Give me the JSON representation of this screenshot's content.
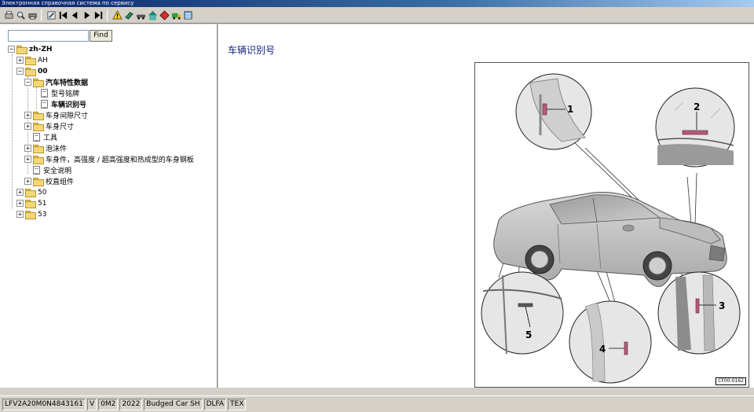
{
  "window": {
    "title": "Электронная справочная система по сервису"
  },
  "toolbar": {
    "icons": [
      "print-icon",
      "find-icon",
      "printer-icon",
      "settings-icon",
      "first-icon",
      "previous-icon",
      "next-icon",
      "last-icon",
      "warning-icon",
      "green-arrow-icon",
      "car-link-icon",
      "house-icon",
      "red-diamond-icon",
      "truck-icon",
      "list-icon"
    ]
  },
  "search": {
    "value": "",
    "button": "Find"
  },
  "tree": {
    "root": "zh-ZH",
    "items": [
      {
        "label": "AH"
      },
      {
        "label": "00"
      },
      {
        "label": "汽车特性数据"
      },
      {
        "label": "型号铭牌"
      },
      {
        "label": "车辆识别号"
      },
      {
        "label": "车身间隙尺寸"
      },
      {
        "label": "车身尺寸"
      },
      {
        "label": "工具"
      },
      {
        "label": "泡沫件"
      },
      {
        "label": "车身件，高强度 / 超高强度和热成型的车身钢板"
      },
      {
        "label": "安全说明"
      },
      {
        "label": "校直组件"
      },
      {
        "label": "50"
      },
      {
        "label": "51"
      },
      {
        "label": "53"
      }
    ]
  },
  "content": {
    "title": "车辆识别号",
    "figure": {
      "callouts": [
        "1",
        "2",
        "3",
        "4",
        "5"
      ],
      "code": "CF00-0162"
    }
  },
  "status": {
    "vin": "LFV2A20M0N4843161",
    "v": "V",
    "model": "0M2",
    "year": "2022",
    "name": "Budged Car SH",
    "engine": "DLFA",
    "tex": "TEX"
  }
}
